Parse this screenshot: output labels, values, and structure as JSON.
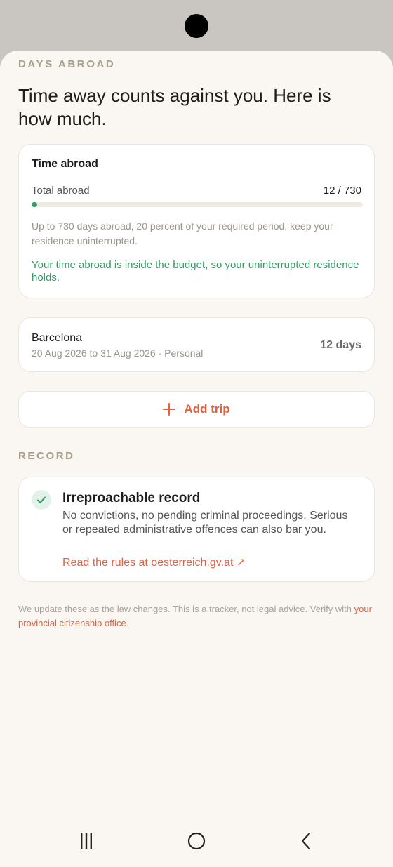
{
  "section_days_label": "DAYS ABROAD",
  "headline": "Time away counts against you. Here is how much.",
  "time_card": {
    "title": "Time abroad",
    "total_label": "Total abroad",
    "total_value": "12 / 730",
    "progress_fraction": 0.016,
    "explain": "Up to 730 days abroad, 20 percent of your required period, keep your residence uninterrupted.",
    "status": "Your time abroad is inside the budget, so your uninterrupted residence holds.",
    "status_color": "#2f9d63"
  },
  "trip": {
    "name": "Barcelona",
    "meta": "20 Aug 2026 to 31 Aug 2026 · Personal",
    "days": "12 days"
  },
  "add_trip_label": "Add trip",
  "section_record_label": "RECORD",
  "record_card": {
    "title": "Irreproachable record",
    "description": "No convictions, no pending criminal proceedings. Serious or repeated administrative offences can also bar you.",
    "link": "Read the rules at oesterreich.gv.at ↗"
  },
  "footer": {
    "text": "We update these as the law changes. This is a tracker, not legal advice. Verify with ",
    "link": "your provincial citizenship office",
    "tail": "."
  },
  "colors": {
    "accent": "#e4603f",
    "success": "#2f9d63",
    "background": "#faf7f2"
  },
  "icons": {
    "add": "plus-icon",
    "check": "check-icon",
    "nav_recent": "recent-apps-icon",
    "nav_home": "home-icon",
    "nav_back": "back-icon"
  }
}
